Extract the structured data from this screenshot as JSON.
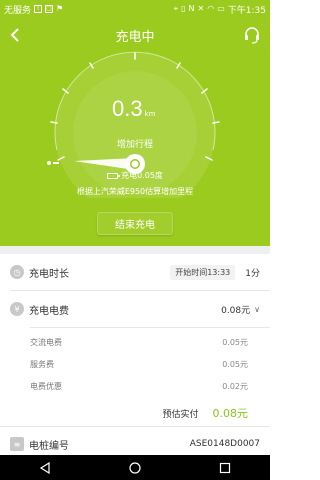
{
  "status_bar": {
    "carrier": "无服务",
    "time": "下午1:35"
  },
  "header": {
    "title": "充电中"
  },
  "gauge": {
    "value": "0.3",
    "unit": "km",
    "caption": "增加行程"
  },
  "charging": {
    "amount": "充电0.05度",
    "estimate": "根据上汽荣威E950估算增加里程",
    "end_button": "结束充电"
  },
  "details": {
    "duration_label": "充电时长",
    "start_time": "开始时间13:33",
    "duration_value": "1分",
    "fee_label": "充电电费",
    "fee_value": "0.08元",
    "ac_fee_label": "交流电费",
    "ac_fee_value": "0.05元",
    "service_fee_label": "服务费",
    "service_fee_value": "0.05元",
    "discount_label": "电费优惠",
    "discount_value": "0.02元",
    "total_label": "预估实付",
    "total_value": "0.08元",
    "pile_label": "电桩编号",
    "pile_value": "ASE0148D0007"
  },
  "colors": {
    "accent": "#9ccb1f",
    "total_text": "#8cc320"
  }
}
